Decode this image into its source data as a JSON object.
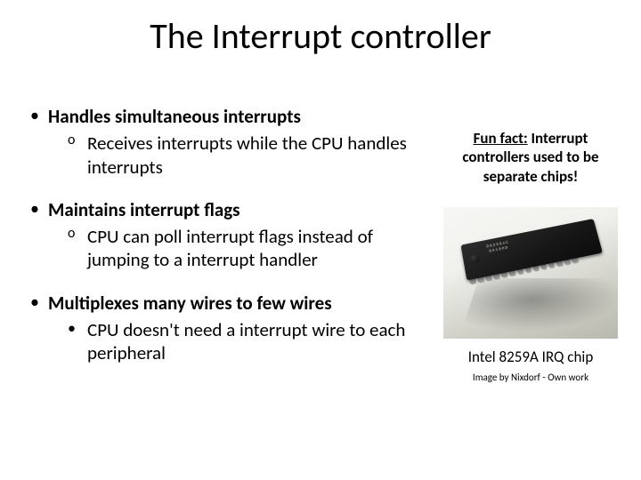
{
  "title": "The Interrupt controller",
  "bullets": [
    {
      "head": "Handles simultaneous interrupts",
      "sub_style": "circ",
      "sub": "Receives interrupts while the CPU handles interrupts"
    },
    {
      "head": "Maintains interrupt flags",
      "sub_style": "circ",
      "sub": "CPU can poll interrupt flags instead of jumping to a interrupt handler"
    },
    {
      "head": "Multiplexes many wires to few wires",
      "sub_style": "disc",
      "sub": "CPU doesn't need a interrupt wire to each peripheral"
    }
  ],
  "funfact": {
    "lead": "Fun fact:",
    "rest": " Interrupt controllers used to be separate chips!"
  },
  "chip_marking": "D8259AC\n8618HD",
  "caption": "Intel 8259A IRQ chip",
  "credit": "Image by Nixdorf - Own work"
}
